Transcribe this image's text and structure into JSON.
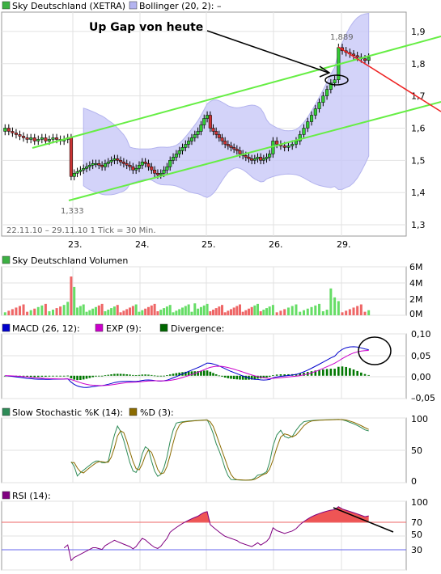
{
  "chart_data": [
    {
      "id": "price",
      "type": "candlestick",
      "legend": [
        {
          "label": "Sky Deutschland (XETRA)",
          "color": "#3cb043"
        },
        {
          "label": "Bollinger (20, 2):  –",
          "color": "#b4b4f0"
        }
      ],
      "annotation": "Up Gap von heute",
      "range_label": "22.11.10 – 29.11.10   1 Tick = 30 Min.",
      "high_label": "1,889",
      "low_label": "1,333",
      "x_tick_labels": [
        "23.",
        "24.",
        "25.",
        "26.",
        "29."
      ],
      "y_ticks": [
        {
          "value": 1.9,
          "label": "1,9"
        },
        {
          "value": 1.8,
          "label": "1,8"
        },
        {
          "value": 1.7,
          "label": "1,7"
        },
        {
          "value": 1.6,
          "label": "1,6"
        },
        {
          "value": 1.5,
          "label": "1,5"
        },
        {
          "value": 1.4,
          "label": "1,4"
        },
        {
          "value": 1.3,
          "label": "1,3"
        }
      ],
      "ylim": [
        1.265,
        1.96
      ],
      "close": [
        1.6,
        1.59,
        1.585,
        1.58,
        1.575,
        1.57,
        1.565,
        1.57,
        1.56,
        1.565,
        1.57,
        1.56,
        1.565,
        1.57,
        1.565,
        1.56,
        1.565,
        1.57,
        1.45,
        1.46,
        1.465,
        1.47,
        1.475,
        1.48,
        1.485,
        1.49,
        1.49,
        1.485,
        1.48,
        1.49,
        1.495,
        1.5,
        1.505,
        1.5,
        1.495,
        1.49,
        1.485,
        1.48,
        1.47,
        1.475,
        1.485,
        1.495,
        1.49,
        1.48,
        1.47,
        1.46,
        1.455,
        1.46,
        1.47,
        1.48,
        1.5,
        1.51,
        1.52,
        1.53,
        1.54,
        1.55,
        1.56,
        1.57,
        1.58,
        1.59,
        1.61,
        1.63,
        1.64,
        1.6,
        1.59,
        1.58,
        1.57,
        1.56,
        1.55,
        1.545,
        1.54,
        1.535,
        1.53,
        1.52,
        1.515,
        1.51,
        1.505,
        1.5,
        1.505,
        1.51,
        1.5,
        1.505,
        1.51,
        1.52,
        1.56,
        1.55,
        1.545,
        1.54,
        1.545,
        1.55,
        1.56,
        1.58,
        1.6,
        1.62,
        1.64,
        1.66,
        1.68,
        1.7,
        1.72,
        1.74,
        1.75,
        1.85,
        1.84,
        1.835,
        1.83,
        1.825,
        1.82,
        1.815,
        1.81,
        1.82
      ],
      "volume_series": {
        "title": "Sky Deutschland Volumen",
        "y_ticks": [
          "6M",
          "4M",
          "2M",
          "0M"
        ],
        "ylim": [
          0,
          6.5
        ]
      },
      "macd": {
        "legend": [
          "MACD (26, 12):",
          "EXP (9):",
          "Divergence:"
        ],
        "colors": [
          "#0000cc",
          "#cc00cc",
          "#006600"
        ],
        "y_ticks": [
          "0,10",
          "0,05",
          "0,00",
          "–0,05"
        ],
        "ylim": [
          -0.06,
          0.11
        ]
      },
      "stochastic": {
        "legend": [
          "Slow Stochastic %K (14):",
          "%D (3):"
        ],
        "colors": [
          "#2e8b57",
          "#8b6b00"
        ],
        "y_ticks": [
          "100",
          "50",
          "0"
        ],
        "ylim": [
          0,
          100
        ]
      },
      "rsi": {
        "legend": [
          "RSI (14):"
        ],
        "color": "#800080",
        "y_ticks": [
          "100",
          "70",
          "50",
          "30"
        ],
        "levels": [
          70,
          30
        ],
        "ylim": [
          0,
          100
        ]
      }
    }
  ]
}
